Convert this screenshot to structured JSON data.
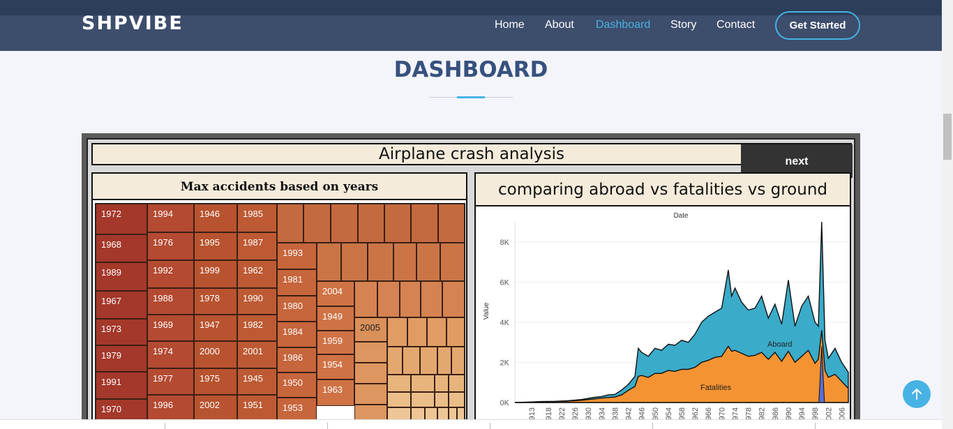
{
  "header": {
    "logo": "SHPVIBE",
    "nav": [
      "Home",
      "About",
      "Dashboard",
      "Story",
      "Contact"
    ],
    "active_nav": "Dashboard",
    "cta": "Get Started",
    "accent": "#47b2e4",
    "bg": "#3d4d6c"
  },
  "section_title": "DASHBOARD",
  "dashboard": {
    "title": "Airplane crash analysis",
    "next_button": "next",
    "left_panel": {
      "title": "Max accidents based on years",
      "tile_labels": [
        "1972",
        "1968",
        "1989",
        "1967",
        "1973",
        "1979",
        "1991",
        "1970",
        "1994",
        "1976",
        "1992",
        "1988",
        "1969",
        "1974",
        "1977",
        "1996",
        "1946",
        "1995",
        "1999",
        "1978",
        "1947",
        "2000",
        "1975",
        "2002",
        "1985",
        "1987",
        "1962",
        "1990",
        "1982",
        "2001",
        "1945",
        "1951",
        "1993",
        "1981",
        "1980",
        "1984",
        "1986",
        "1950",
        "1953",
        "2004",
        "1949",
        "1959",
        "1954",
        "1963",
        "2005"
      ]
    },
    "right_panel": {
      "title": "comparing abroad vs fatalities vs ground"
    }
  },
  "chart_data": {
    "type": "area",
    "title": "Date",
    "xlabel": "Date",
    "ylabel": "Value",
    "y_ticks": [
      "0K",
      "2K",
      "4K",
      "6K",
      "8K"
    ],
    "ylim": [
      0,
      9000
    ],
    "x_ticks": [
      "1913",
      "1918",
      "1922",
      "1926",
      "1930",
      "1934",
      "1938",
      "1942",
      "1946",
      "1950",
      "1954",
      "1958",
      "1962",
      "1966",
      "1970",
      "1974",
      "1978",
      "1982",
      "1986",
      "1990",
      "1994",
      "1998",
      "2002",
      "2006"
    ],
    "x": [
      1908,
      1912,
      1916,
      1920,
      1924,
      1928,
      1932,
      1934,
      1936,
      1938,
      1940,
      1942,
      1944,
      1945,
      1946,
      1948,
      1950,
      1952,
      1954,
      1956,
      1958,
      1960,
      1962,
      1964,
      1966,
      1968,
      1970,
      1972,
      1973,
      1974,
      1976,
      1978,
      1980,
      1982,
      1984,
      1986,
      1988,
      1990,
      1992,
      1994,
      1996,
      1998,
      1999,
      2000,
      2001,
      2002,
      2004,
      2006,
      2008
    ],
    "series": [
      {
        "name": "Aboard",
        "color": "#3aabc9",
        "values": [
          0,
          20,
          50,
          60,
          90,
          150,
          260,
          300,
          380,
          400,
          620,
          900,
          1300,
          2700,
          2500,
          2300,
          2700,
          2600,
          2900,
          2850,
          3100,
          3000,
          3400,
          4000,
          4300,
          4500,
          4700,
          6600,
          5300,
          5700,
          5000,
          4600,
          4700,
          5300,
          4200,
          4900,
          3900,
          6100,
          3800,
          4800,
          5300,
          4000,
          3800,
          9000,
          3100,
          2200,
          2700,
          2000,
          1500
        ]
      },
      {
        "name": "Fatalities",
        "color": "#f59332",
        "values": [
          0,
          15,
          40,
          50,
          70,
          110,
          180,
          220,
          250,
          270,
          380,
          600,
          800,
          1300,
          1350,
          1250,
          1450,
          1450,
          1600,
          1550,
          1650,
          1650,
          1750,
          2000,
          2100,
          2250,
          2300,
          2800,
          2550,
          2600,
          2450,
          2300,
          2350,
          2500,
          2150,
          2500,
          2050,
          2550,
          2000,
          2300,
          2600,
          1950,
          2150,
          3600,
          1600,
          1250,
          1400,
          1050,
          700
        ]
      },
      {
        "name": "Ground",
        "color": "#5b6fd1",
        "values": [
          0,
          0,
          0,
          0,
          0,
          0,
          0,
          0,
          0,
          0,
          0,
          0,
          0,
          0,
          0,
          0,
          0,
          0,
          0,
          0,
          0,
          0,
          0,
          0,
          0,
          0,
          0,
          0,
          0,
          0,
          0,
          0,
          0,
          0,
          0,
          0,
          0,
          0,
          0,
          0,
          0,
          0,
          0,
          2800,
          0,
          0,
          0,
          0,
          0
        ]
      }
    ],
    "annotations": [
      "Aboard",
      "Fatalities"
    ],
    "grid": true
  }
}
